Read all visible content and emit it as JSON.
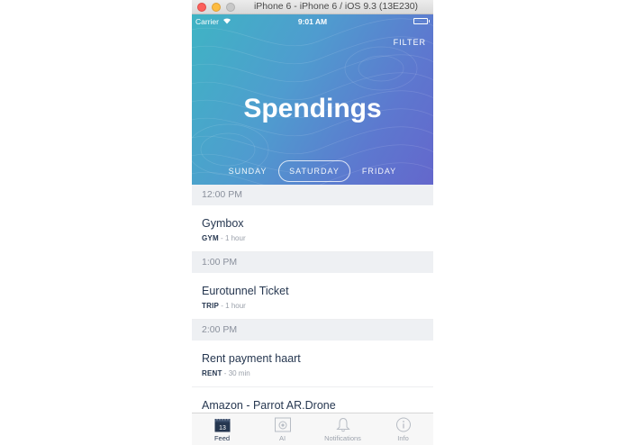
{
  "window": {
    "title": "iPhone 6 - iPhone 6 / iOS 9.3 (13E230)"
  },
  "status_bar": {
    "carrier": "Carrier",
    "time": "9:01 AM"
  },
  "header": {
    "filter_label": "FILTER",
    "title": "Spendings",
    "days": [
      "SUNDAY",
      "SATURDAY",
      "FRIDAY"
    ],
    "selected_day": "SATURDAY"
  },
  "feed": [
    {
      "time": "12:00 PM",
      "title": "Gymbox",
      "category": "GYM",
      "duration": "1 hour"
    },
    {
      "time": "1:00 PM",
      "title": "Eurotunnel Ticket",
      "category": "TRIP",
      "duration": "1 hour"
    },
    {
      "time": "2:00 PM",
      "title": "Rent payment haart",
      "category": "RENT",
      "duration": "30 min"
    },
    {
      "time": "",
      "title": "Amazon - Parrot AR.Drone",
      "category": "",
      "duration": ""
    }
  ],
  "tabbar": {
    "tabs": [
      {
        "label": "Feed",
        "icon": "calendar-icon",
        "badge": "13",
        "active": true
      },
      {
        "label": "AI",
        "icon": "camera-icon",
        "active": false
      },
      {
        "label": "Notifications",
        "icon": "bell-icon",
        "active": false
      },
      {
        "label": "Info",
        "icon": "info-icon",
        "active": false
      }
    ]
  },
  "colors": {
    "gradient_start": "#3fb4c4",
    "gradient_end": "#6467cc",
    "text_dark": "#263750",
    "section_bg": "#eef0f3"
  }
}
